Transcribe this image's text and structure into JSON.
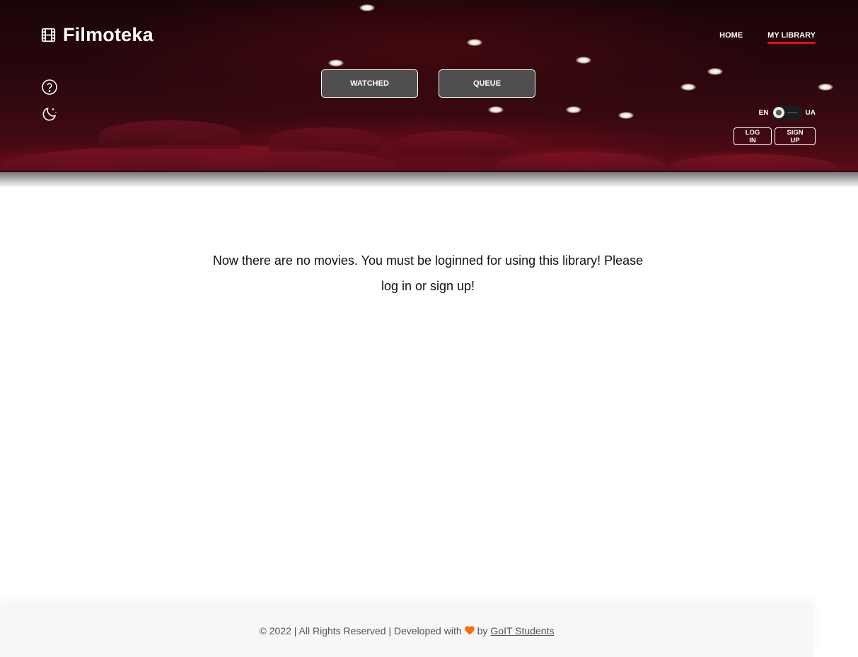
{
  "header": {
    "logo_text": "Filmoteka",
    "nav": [
      {
        "label": "HOME",
        "active": false
      },
      {
        "label": "MY LIBRARY",
        "active": true
      }
    ],
    "library_buttons": {
      "watched": "WATCHED",
      "queue": "QUEUE"
    },
    "lang": {
      "left": "EN",
      "right": "UA",
      "selected": "EN"
    },
    "auth": {
      "login": "LOG IN",
      "signup": "SIGN UP"
    },
    "icons": [
      "film-icon",
      "help-circle-icon",
      "moon-stars-icon"
    ]
  },
  "main": {
    "message": "Now there are no movies. You must be loginned for using this library! Please log in or sign up!"
  },
  "footer": {
    "text": "© 2022 | All Rights Reserved | Developed with",
    "by": "by",
    "link": "GoIT Students",
    "heart_color": "#ff6b08"
  },
  "colors": {
    "accent": "#e00d1a",
    "button_bg": "#4f4f4f"
  }
}
